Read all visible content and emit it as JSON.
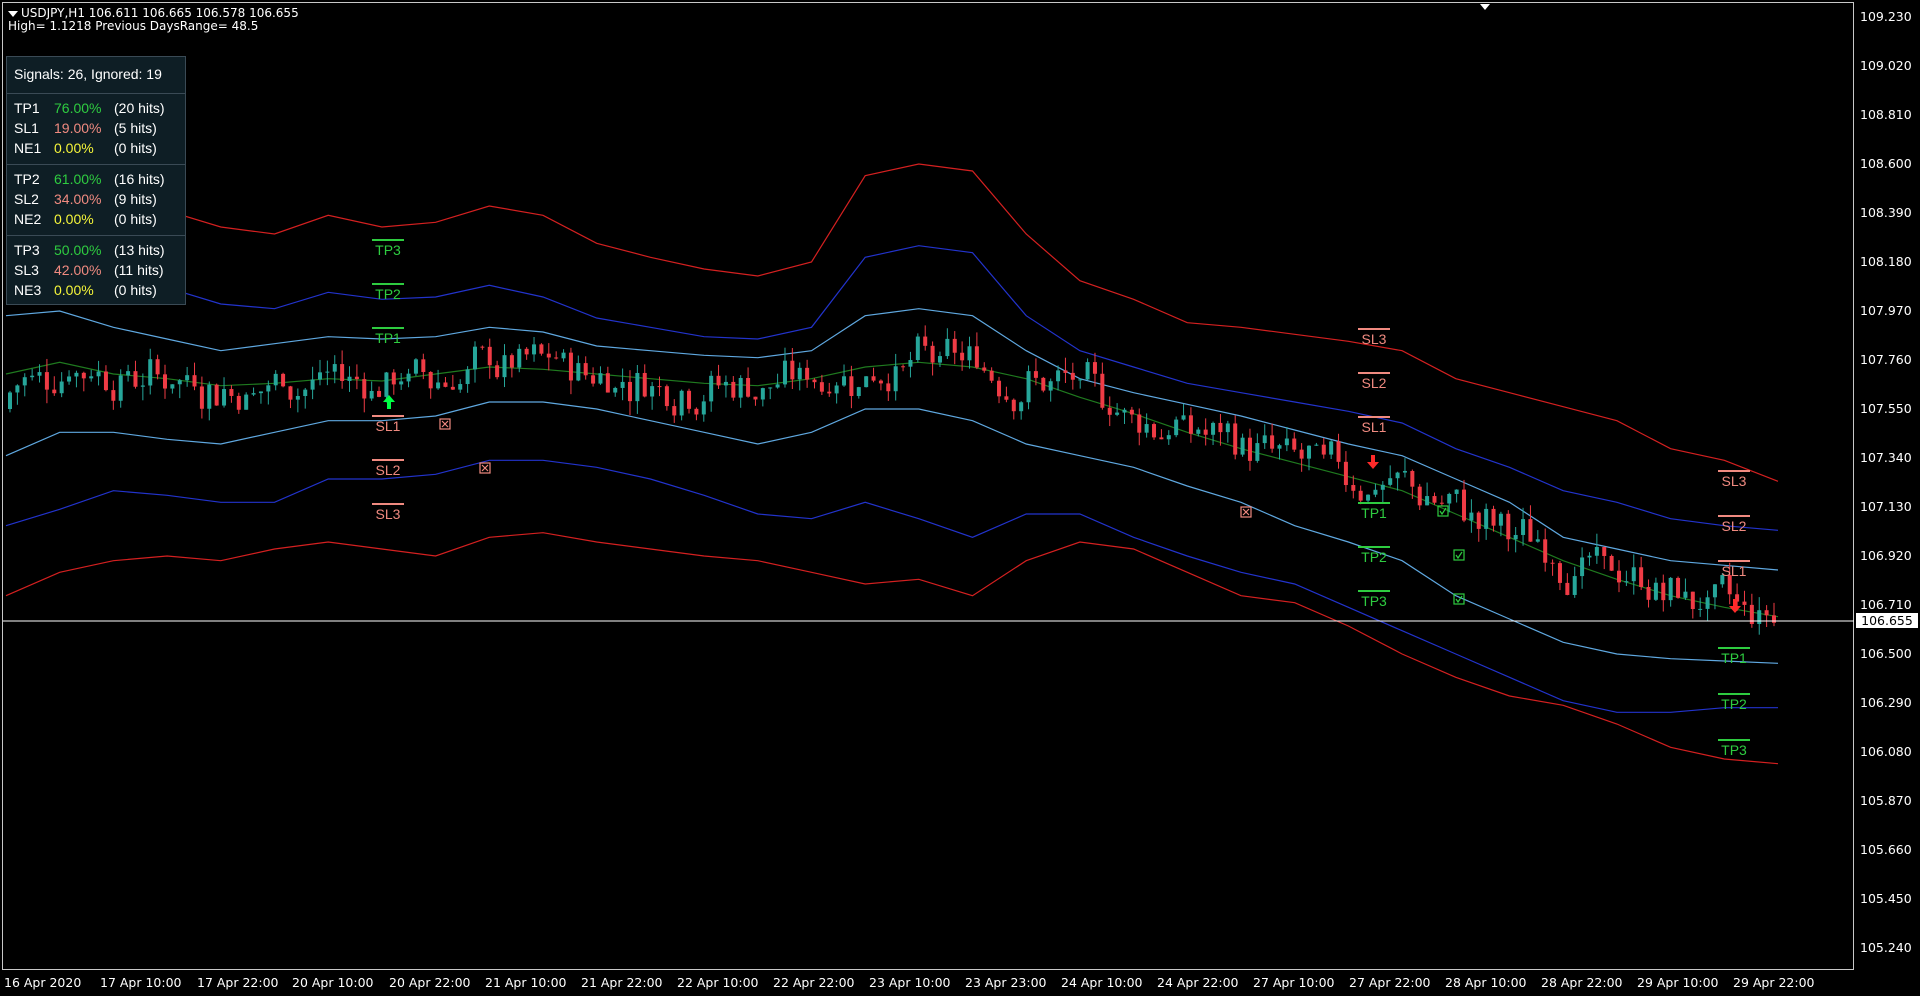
{
  "header": {
    "line1": "USDJPY,H1  106.611 106.665 106.578 106.655",
    "line2": "High= 1.1218 Previous DaysRange= 48.5"
  },
  "stats": {
    "summary": "Signals: 26, Ignored: 19",
    "groups": [
      [
        {
          "name": "TP1",
          "pct": "76.00%",
          "hits": "(20 hits)"
        },
        {
          "name": "SL1",
          "pct": "19.00%",
          "hits": "(5 hits)"
        },
        {
          "name": "NE1",
          "pct": "0.00%",
          "hits": "(0 hits)"
        }
      ],
      [
        {
          "name": "TP2",
          "pct": "61.00%",
          "hits": "(16 hits)"
        },
        {
          "name": "SL2",
          "pct": "34.00%",
          "hits": "(9 hits)"
        },
        {
          "name": "NE2",
          "pct": "0.00%",
          "hits": "(0 hits)"
        }
      ],
      [
        {
          "name": "TP3",
          "pct": "50.00%",
          "hits": "(13 hits)"
        },
        {
          "name": "SL3",
          "pct": "42.00%",
          "hits": "(11 hits)"
        },
        {
          "name": "NE3",
          "pct": "0.00%",
          "hits": "(0 hits)"
        }
      ]
    ]
  },
  "price_axis": [
    "109.230",
    "109.020",
    "108.810",
    "108.600",
    "108.390",
    "108.180",
    "107.970",
    "107.760",
    "107.550",
    "107.340",
    "107.130",
    "106.920",
    "106.710",
    "106.500",
    "106.290",
    "106.080",
    "105.870",
    "105.660",
    "105.450",
    "105.240"
  ],
  "current_price": "106.655",
  "time_axis": [
    "16 Apr 2020",
    "17 Apr 10:00",
    "17 Apr 22:00",
    "20 Apr 10:00",
    "20 Apr 22:00",
    "21 Apr 10:00",
    "21 Apr 22:00",
    "22 Apr 10:00",
    "22 Apr 22:00",
    "23 Apr 10:00",
    "23 Apr 23:00",
    "24 Apr 10:00",
    "24 Apr 22:00",
    "27 Apr 10:00",
    "27 Apr 22:00",
    "28 Apr 10:00",
    "28 Apr 22:00",
    "29 Apr 10:00",
    "29 Apr 22:00"
  ],
  "level_labels": {
    "tp1": "TP1",
    "tp2": "TP2",
    "tp3": "TP3",
    "sl1": "SL1",
    "sl2": "SL2",
    "sl3": "SL3"
  },
  "colors": {
    "bull": "#26a69a",
    "bear": "#ef3b45",
    "band_outer": "#d42020",
    "band_mid": "#2233cc",
    "band_inner": "#5fa8e0",
    "ma": "#1f7a1f",
    "tp": "#2ecc40",
    "sl": "#f08a80",
    "ne": "#f5f53a",
    "buy_arrow": "#00ff44",
    "sell_arrow": "#ff2a2a"
  },
  "chart_data": {
    "type": "candlestick",
    "symbol": "USDJPY",
    "timeframe": "H1",
    "ylim": [
      105.24,
      109.23
    ],
    "last_price": 106.655,
    "band_series": [
      {
        "name": "outer_upper",
        "values": [
          108.55,
          108.62,
          108.5,
          108.4,
          108.33,
          108.3,
          108.38,
          108.33,
          108.35,
          108.42,
          108.38,
          108.26,
          108.2,
          108.15,
          108.12,
          108.18,
          108.55,
          108.6,
          108.57,
          108.3,
          108.1,
          108.02,
          107.92,
          107.9,
          107.87,
          107.84,
          107.8,
          107.68,
          107.62,
          107.56,
          107.5,
          107.38,
          107.33,
          107.24
        ]
      },
      {
        "name": "mid_upper",
        "values": [
          108.2,
          108.25,
          108.15,
          108.07,
          108.0,
          107.98,
          108.05,
          108.02,
          108.03,
          108.08,
          108.03,
          107.94,
          107.9,
          107.86,
          107.85,
          107.9,
          108.2,
          108.25,
          108.22,
          107.95,
          107.8,
          107.73,
          107.66,
          107.62,
          107.58,
          107.54,
          107.49,
          107.38,
          107.3,
          107.2,
          107.15,
          107.08,
          107.05,
          107.03
        ]
      },
      {
        "name": "inner_upper",
        "values": [
          107.95,
          107.97,
          107.9,
          107.85,
          107.8,
          107.83,
          107.86,
          107.85,
          107.86,
          107.9,
          107.88,
          107.82,
          107.8,
          107.78,
          107.77,
          107.8,
          107.95,
          107.98,
          107.95,
          107.8,
          107.68,
          107.62,
          107.57,
          107.52,
          107.46,
          107.4,
          107.35,
          107.25,
          107.15,
          107.0,
          106.95,
          106.9,
          106.88,
          106.86
        ]
      },
      {
        "name": "ma",
        "values": [
          107.7,
          107.75,
          107.7,
          107.68,
          107.65,
          107.66,
          107.68,
          107.67,
          107.7,
          107.73,
          107.72,
          107.7,
          107.68,
          107.66,
          107.65,
          107.68,
          107.73,
          107.75,
          107.73,
          107.68,
          107.6,
          107.53,
          107.45,
          107.38,
          107.32,
          107.26,
          107.2,
          107.1,
          107.0,
          106.9,
          106.82,
          106.75,
          106.7,
          106.66
        ]
      },
      {
        "name": "inner_lower",
        "values": [
          107.35,
          107.45,
          107.45,
          107.42,
          107.4,
          107.45,
          107.5,
          107.5,
          107.52,
          107.58,
          107.58,
          107.55,
          107.5,
          107.45,
          107.4,
          107.45,
          107.55,
          107.55,
          107.5,
          107.4,
          107.35,
          107.3,
          107.22,
          107.15,
          107.05,
          106.98,
          106.9,
          106.75,
          106.65,
          106.55,
          106.5,
          106.48,
          106.47,
          106.46
        ]
      },
      {
        "name": "mid_lower",
        "values": [
          107.05,
          107.12,
          107.2,
          107.18,
          107.15,
          107.15,
          107.25,
          107.25,
          107.27,
          107.33,
          107.33,
          107.3,
          107.25,
          107.18,
          107.1,
          107.08,
          107.15,
          107.08,
          107.0,
          107.1,
          107.1,
          107.0,
          106.92,
          106.85,
          106.8,
          106.7,
          106.6,
          106.5,
          106.4,
          106.3,
          106.25,
          106.25,
          106.27,
          106.27
        ]
      },
      {
        "name": "outer_lower",
        "values": [
          106.75,
          106.85,
          106.9,
          106.92,
          106.9,
          106.95,
          106.98,
          106.95,
          106.92,
          107.0,
          107.02,
          106.98,
          106.95,
          106.92,
          106.9,
          106.85,
          106.8,
          106.82,
          106.75,
          106.9,
          106.98,
          106.95,
          106.85,
          106.75,
          106.72,
          106.62,
          106.5,
          106.4,
          106.32,
          106.28,
          106.2,
          106.1,
          106.05,
          106.03
        ]
      }
    ]
  }
}
